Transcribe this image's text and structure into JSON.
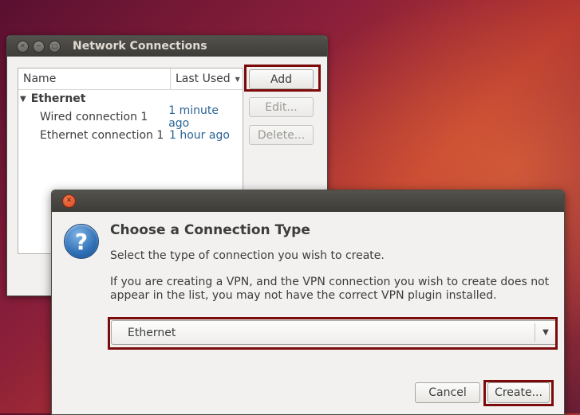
{
  "main_window": {
    "title": "Network Connections",
    "columns": {
      "name": "Name",
      "last_used": "Last Used"
    },
    "group": "Ethernet",
    "connections": [
      {
        "name": "Wired connection 1",
        "last_used": "1 minute ago"
      },
      {
        "name": "Ethernet connection 1",
        "last_used": "1 hour ago"
      }
    ],
    "buttons": {
      "add": "Add",
      "edit": "Edit...",
      "delete": "Delete..."
    }
  },
  "dialog": {
    "heading": "Choose a Connection Type",
    "line1": "Select the type of connection you wish to create.",
    "line2a": "If you are creating a VPN, and the VPN connection you wish to create does not",
    "line2b": "appear in the list, you may not have the correct VPN plugin installed.",
    "selected_type": "Ethernet",
    "cancel_label": "Cancel",
    "create_label": "Create..."
  },
  "icons": {
    "close": "✕",
    "minimize": "−",
    "maximize": "□",
    "question": "?",
    "dropdown": "▼",
    "expander": "▼",
    "sort": "▼"
  },
  "colors": {
    "highlight": "#7b0a0a",
    "link_text": "#2a6495"
  }
}
